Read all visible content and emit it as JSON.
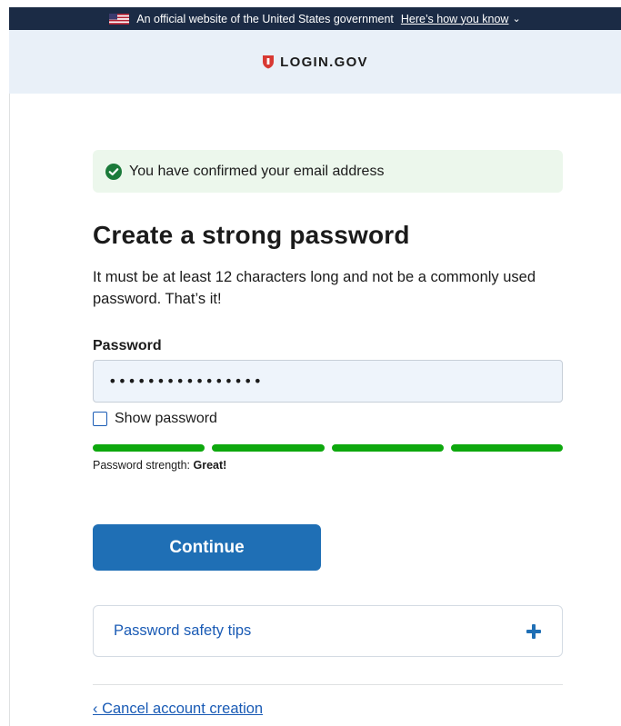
{
  "banner": {
    "text": "An official website of the United States government",
    "link": "Here’s how you know",
    "chevron": "⌄"
  },
  "header": {
    "logo_text": "LOGIN.GOV",
    "logo_icon": "shield-icon"
  },
  "alert": {
    "message": "You have confirmed your email address",
    "icon": "check-circle-icon"
  },
  "main": {
    "title": "Create a strong password",
    "description": "It must be at least 12 characters long and not be a commonly used password. That’s it!"
  },
  "password": {
    "label": "Password",
    "value": "••••••••••••••••",
    "show_password_label": "Show password",
    "show_password_checked": false
  },
  "strength": {
    "label": "Password strength:",
    "value": "Great!",
    "segments_filled": 4,
    "segments_total": 4,
    "color": "#0ea80e"
  },
  "actions": {
    "continue_label": "Continue"
  },
  "tips": {
    "label": "Password safety tips",
    "icon": "plus-icon"
  },
  "footer": {
    "cancel_label": "‹ Cancel account creation"
  },
  "colors": {
    "primary": "#1f6fb5",
    "link": "#1a5bb5",
    "success": "#0ea80e",
    "banner_bg": "#1b2b45",
    "header_bg": "#e9f0f8",
    "alert_bg": "#ecf7ec",
    "logo_red": "#d83933"
  }
}
